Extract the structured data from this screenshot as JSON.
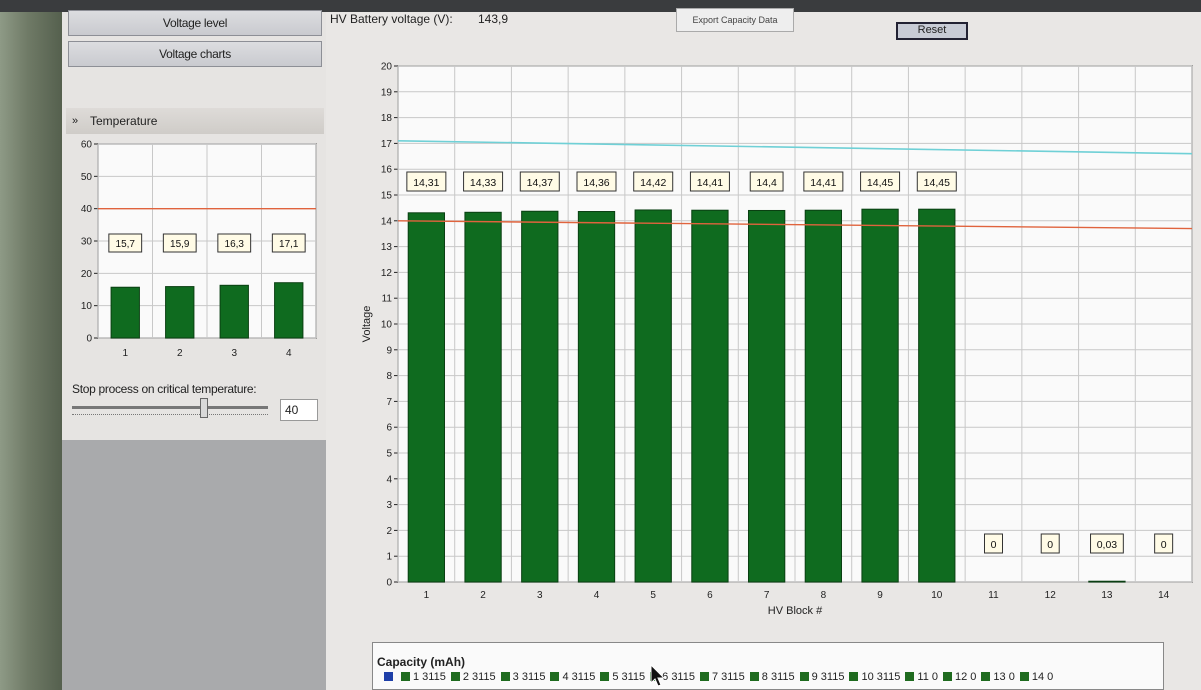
{
  "navigation": {
    "voltage_level": "Voltage level",
    "voltage_charts": "Voltage charts"
  },
  "temperature_section": {
    "title": "Temperature",
    "chevron_glyph": "»",
    "stop_process_label": "Stop process on critical temperature:",
    "critical_temperature_value": "40",
    "slider_value": 40
  },
  "header": {
    "hv_battery_label": "HV Battery voltage (V):",
    "hv_battery_value": "143,9",
    "export_button": "Export Capacity Data",
    "reset_button": "Reset"
  },
  "colors": {
    "bar_green": "#0f6b1f",
    "critical_line_red": "#e0633d",
    "reference_line_cyan": "#6fd0d6",
    "legend_swatch_blue": "#1e3fa8"
  },
  "chart_data": [
    {
      "id": "temperature",
      "type": "bar",
      "categories": [
        "1",
        "2",
        "3",
        "4"
      ],
      "values": [
        15.7,
        15.9,
        16.3,
        17.1
      ],
      "value_labels": [
        "15,7",
        "15,9",
        "16,3",
        "17,1"
      ],
      "ylim": [
        0,
        60
      ],
      "yticks": [
        0,
        10,
        20,
        30,
        40,
        50,
        60
      ],
      "threshold_line": 40,
      "grid": true
    },
    {
      "id": "voltage",
      "type": "bar",
      "categories": [
        "1",
        "2",
        "3",
        "4",
        "5",
        "6",
        "7",
        "8",
        "9",
        "10",
        "11",
        "12",
        "13",
        "14"
      ],
      "values": [
        14.31,
        14.33,
        14.37,
        14.36,
        14.42,
        14.41,
        14.4,
        14.41,
        14.45,
        14.45,
        0,
        0,
        0.03,
        0
      ],
      "value_labels": [
        "14,31",
        "14,33",
        "14,37",
        "14,36",
        "14,42",
        "14,41",
        "14,4",
        "14,41",
        "14,45",
        "14,45",
        "0",
        "0",
        "0,03",
        "0"
      ],
      "ylabel": "Voltage",
      "xlabel": "HV Block #",
      "ylim": [
        0,
        20
      ],
      "yticks": [
        0,
        1,
        2,
        3,
        4,
        5,
        6,
        7,
        8,
        9,
        10,
        11,
        12,
        13,
        14,
        15,
        16,
        17,
        18,
        19,
        20
      ],
      "lower_line_start": 14.0,
      "lower_line_end": 13.7,
      "upper_line_start": 17.1,
      "upper_line_end": 16.6,
      "grid": true
    }
  ],
  "legend": {
    "title": "Capacity (mAh)",
    "entries": [
      {
        "label": "",
        "value": "",
        "swatch": "blue"
      },
      {
        "label": "1",
        "value": "3115"
      },
      {
        "label": "2",
        "value": "3115"
      },
      {
        "label": "3",
        "value": "3115"
      },
      {
        "label": "4",
        "value": "3115"
      },
      {
        "label": "5",
        "value": "3115"
      },
      {
        "label": "6",
        "value": "3115"
      },
      {
        "label": "7",
        "value": "3115"
      },
      {
        "label": "8",
        "value": "3115"
      },
      {
        "label": "9",
        "value": "3115"
      },
      {
        "label": "10",
        "value": "3115"
      },
      {
        "label": "11",
        "value": "0"
      },
      {
        "label": "12",
        "value": "0"
      },
      {
        "label": "13",
        "value": "0"
      },
      {
        "label": "14",
        "value": "0"
      }
    ]
  }
}
